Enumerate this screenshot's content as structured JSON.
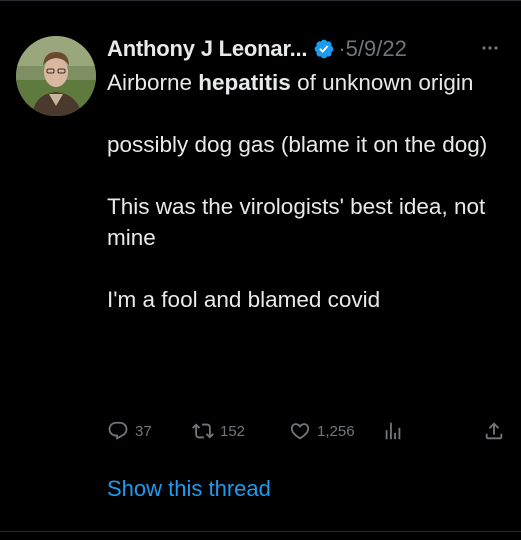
{
  "tweet": {
    "author": {
      "display_name": "Anthony J Leonar...",
      "verified": true
    },
    "separator": "·",
    "date": "5/9/22",
    "body": {
      "p1_before": "Airborne ",
      "p1_bold": "hepatitis",
      "p1_after": " of unknown origin",
      "p2": "possibly dog gas (blame it on the dog)",
      "p3": "This was the virologists' best idea, not mine",
      "p4": "I'm a fool and blamed covid"
    },
    "actions": {
      "replies": "37",
      "retweets": "152",
      "likes": "1,256"
    },
    "show_thread": "Show this thread"
  },
  "colors": {
    "background": "#000000",
    "text": "#e7e9ea",
    "muted": "#71767b",
    "accent": "#1d9bf0"
  },
  "icons": {
    "more": "more-horizontal-icon",
    "verified": "verified-badge-icon",
    "reply": "reply-icon",
    "retweet": "retweet-icon",
    "like": "heart-icon",
    "views": "views-bar-chart-icon",
    "share": "share-icon"
  }
}
